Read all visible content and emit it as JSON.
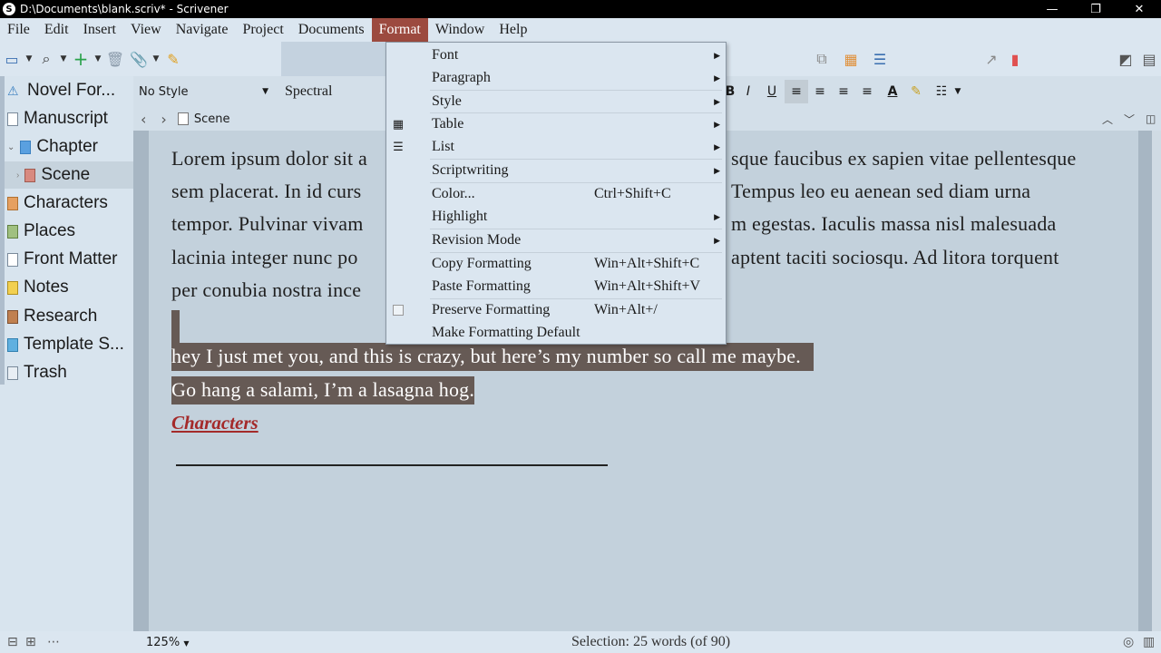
{
  "window": {
    "title": "D:\\Documents\\blank.scriv* - Scrivener",
    "app_icon_letter": "S",
    "minimize": "—",
    "maximize": "❐",
    "close": "✕"
  },
  "menubar": [
    "File",
    "Edit",
    "Insert",
    "View",
    "Navigate",
    "Project",
    "Documents",
    "Format",
    "Window",
    "Help"
  ],
  "binder": {
    "items": [
      {
        "label": "Novel For...",
        "icon": "warning-icon"
      },
      {
        "label": "Manuscript",
        "icon": "manuscript-icon"
      },
      {
        "label": "Chapter",
        "icon": "chapter-icon"
      },
      {
        "label": "Scene",
        "icon": "scene-icon"
      },
      {
        "label": "Characters",
        "icon": "characters-icon"
      },
      {
        "label": "Places",
        "icon": "places-icon"
      },
      {
        "label": "Front Matter",
        "icon": "front-matter-icon"
      },
      {
        "label": "Notes",
        "icon": "notes-icon"
      },
      {
        "label": "Research",
        "icon": "research-icon"
      },
      {
        "label": "Template S...",
        "icon": "template-icon"
      },
      {
        "label": "Trash",
        "icon": "trash-icon"
      }
    ]
  },
  "formatbar": {
    "style": "No Style",
    "font": "Spectral"
  },
  "header": {
    "doc_title": "Scene"
  },
  "editor": {
    "lines": [
      "Lorem ipsum dolor sit a",
      "sem placerat. In id curs",
      "tempor. Pulvinar vivam",
      "lacinia integer nunc po",
      "per conubia nostra ince"
    ],
    "lines_right": [
      "sque faucibus ex sapien vitae pellentesque",
      "Tempus leo eu aenean sed diam urna",
      "m egestas. Iaculis massa nisl malesuada",
      "aptent taciti sociosqu. Ad litora torquent",
      ""
    ],
    "selected_line1": "hey I just met you, and this is crazy, but here’s my number so call me maybe.",
    "selected_line2": "Go hang a salami, I’m a lasagna hog.",
    "link_text": "Characters"
  },
  "format_menu": {
    "items": [
      {
        "label": "Font",
        "shortcut": "",
        "submenu": true,
        "icon": ""
      },
      {
        "label": "Paragraph",
        "shortcut": "",
        "submenu": true,
        "icon": ""
      },
      {
        "label": "Style",
        "shortcut": "",
        "submenu": true,
        "icon": ""
      },
      {
        "label": "Table",
        "shortcut": "",
        "submenu": true,
        "icon": "table-icon"
      },
      {
        "label": "List",
        "shortcut": "",
        "submenu": true,
        "icon": "list-icon"
      },
      {
        "label": "Scriptwriting",
        "shortcut": "",
        "submenu": true,
        "icon": ""
      },
      {
        "label": "Color...",
        "shortcut": "Ctrl+Shift+C",
        "submenu": false,
        "icon": ""
      },
      {
        "label": "Highlight",
        "shortcut": "",
        "submenu": true,
        "icon": ""
      },
      {
        "label": "Revision Mode",
        "shortcut": "",
        "submenu": true,
        "icon": ""
      },
      {
        "label": "Copy Formatting",
        "shortcut": "Win+Alt+Shift+C",
        "submenu": false,
        "icon": ""
      },
      {
        "label": "Paste Formatting",
        "shortcut": "Win+Alt+Shift+V",
        "submenu": false,
        "icon": ""
      },
      {
        "label": "Preserve Formatting",
        "shortcut": "Win+Alt+/",
        "submenu": false,
        "icon": "checkbox-icon"
      },
      {
        "label": "Make Formatting Default",
        "shortcut": "",
        "submenu": false,
        "icon": ""
      }
    ]
  },
  "statusbar": {
    "zoom": "125%",
    "selection": "Selection: 25 words (of 90)"
  },
  "colors": {
    "menu_active": "#9c4a3f",
    "selection": "#665a55",
    "link": "#a42a2a"
  }
}
